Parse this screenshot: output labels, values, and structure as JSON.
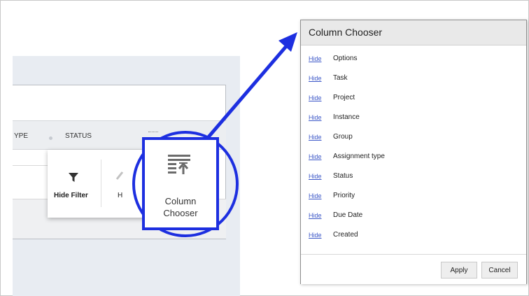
{
  "grid": {
    "header_type_partial": "YPE",
    "header_status": "STATUS"
  },
  "popup_menu": {
    "hide_filter_label": "Hide Filter",
    "partial_label": "H"
  },
  "zoom": {
    "line1": "Column",
    "line2": "Chooser"
  },
  "dialog": {
    "title": "Column Chooser",
    "hide_label": "Hide",
    "columns": [
      {
        "name": "Options"
      },
      {
        "name": "Task"
      },
      {
        "name": "Project"
      },
      {
        "name": "Instance"
      },
      {
        "name": "Group"
      },
      {
        "name": "Assignment type"
      },
      {
        "name": "Status"
      },
      {
        "name": "Priority"
      },
      {
        "name": "Due Date"
      },
      {
        "name": "Created"
      }
    ],
    "apply_label": "Apply",
    "cancel_label": "Cancel"
  },
  "colors": {
    "annotation_blue": "#1d2fe0",
    "link_blue": "#3c57c8"
  },
  "icons": [
    "funnel-icon",
    "column-chooser-icon",
    "arrow-annotation"
  ]
}
